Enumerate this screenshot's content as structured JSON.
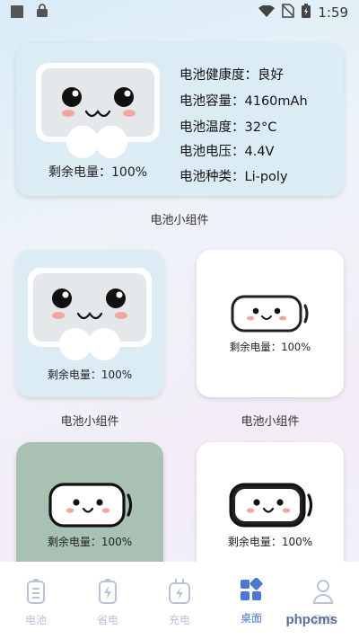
{
  "status_bar": {
    "time": "1:59"
  },
  "large_widget": {
    "remaining": "剩余电量：100%",
    "info": [
      "电池健康度：良好",
      "电池容量：4160mAh",
      "电池温度：32°C",
      "电池电压：4.4V",
      "电池种类：Li-poly"
    ],
    "caption": "电池小组件"
  },
  "widgets": [
    {
      "remaining": "剩余电量：100%",
      "caption": "电池小组件"
    },
    {
      "remaining": "剩余电量：100%",
      "caption": "电池小组件"
    },
    {
      "remaining": "剩余电量：100%"
    },
    {
      "remaining": "剩余电量：100%"
    }
  ],
  "tabs": [
    {
      "label": "电池",
      "icon": "battery-icon"
    },
    {
      "label": "省电",
      "icon": "power-save-icon"
    },
    {
      "label": "充电",
      "icon": "charging-plug-icon"
    },
    {
      "label": "桌面",
      "icon": "desktop-widgets-icon"
    },
    {
      "label": "我的",
      "icon": "profile-icon"
    }
  ],
  "active_tab": "桌面",
  "watermark": "phpcms",
  "colors": {
    "accent": "#4c78d2",
    "card_blue": "#dcecf5",
    "card_green": "#a9c1b3"
  }
}
